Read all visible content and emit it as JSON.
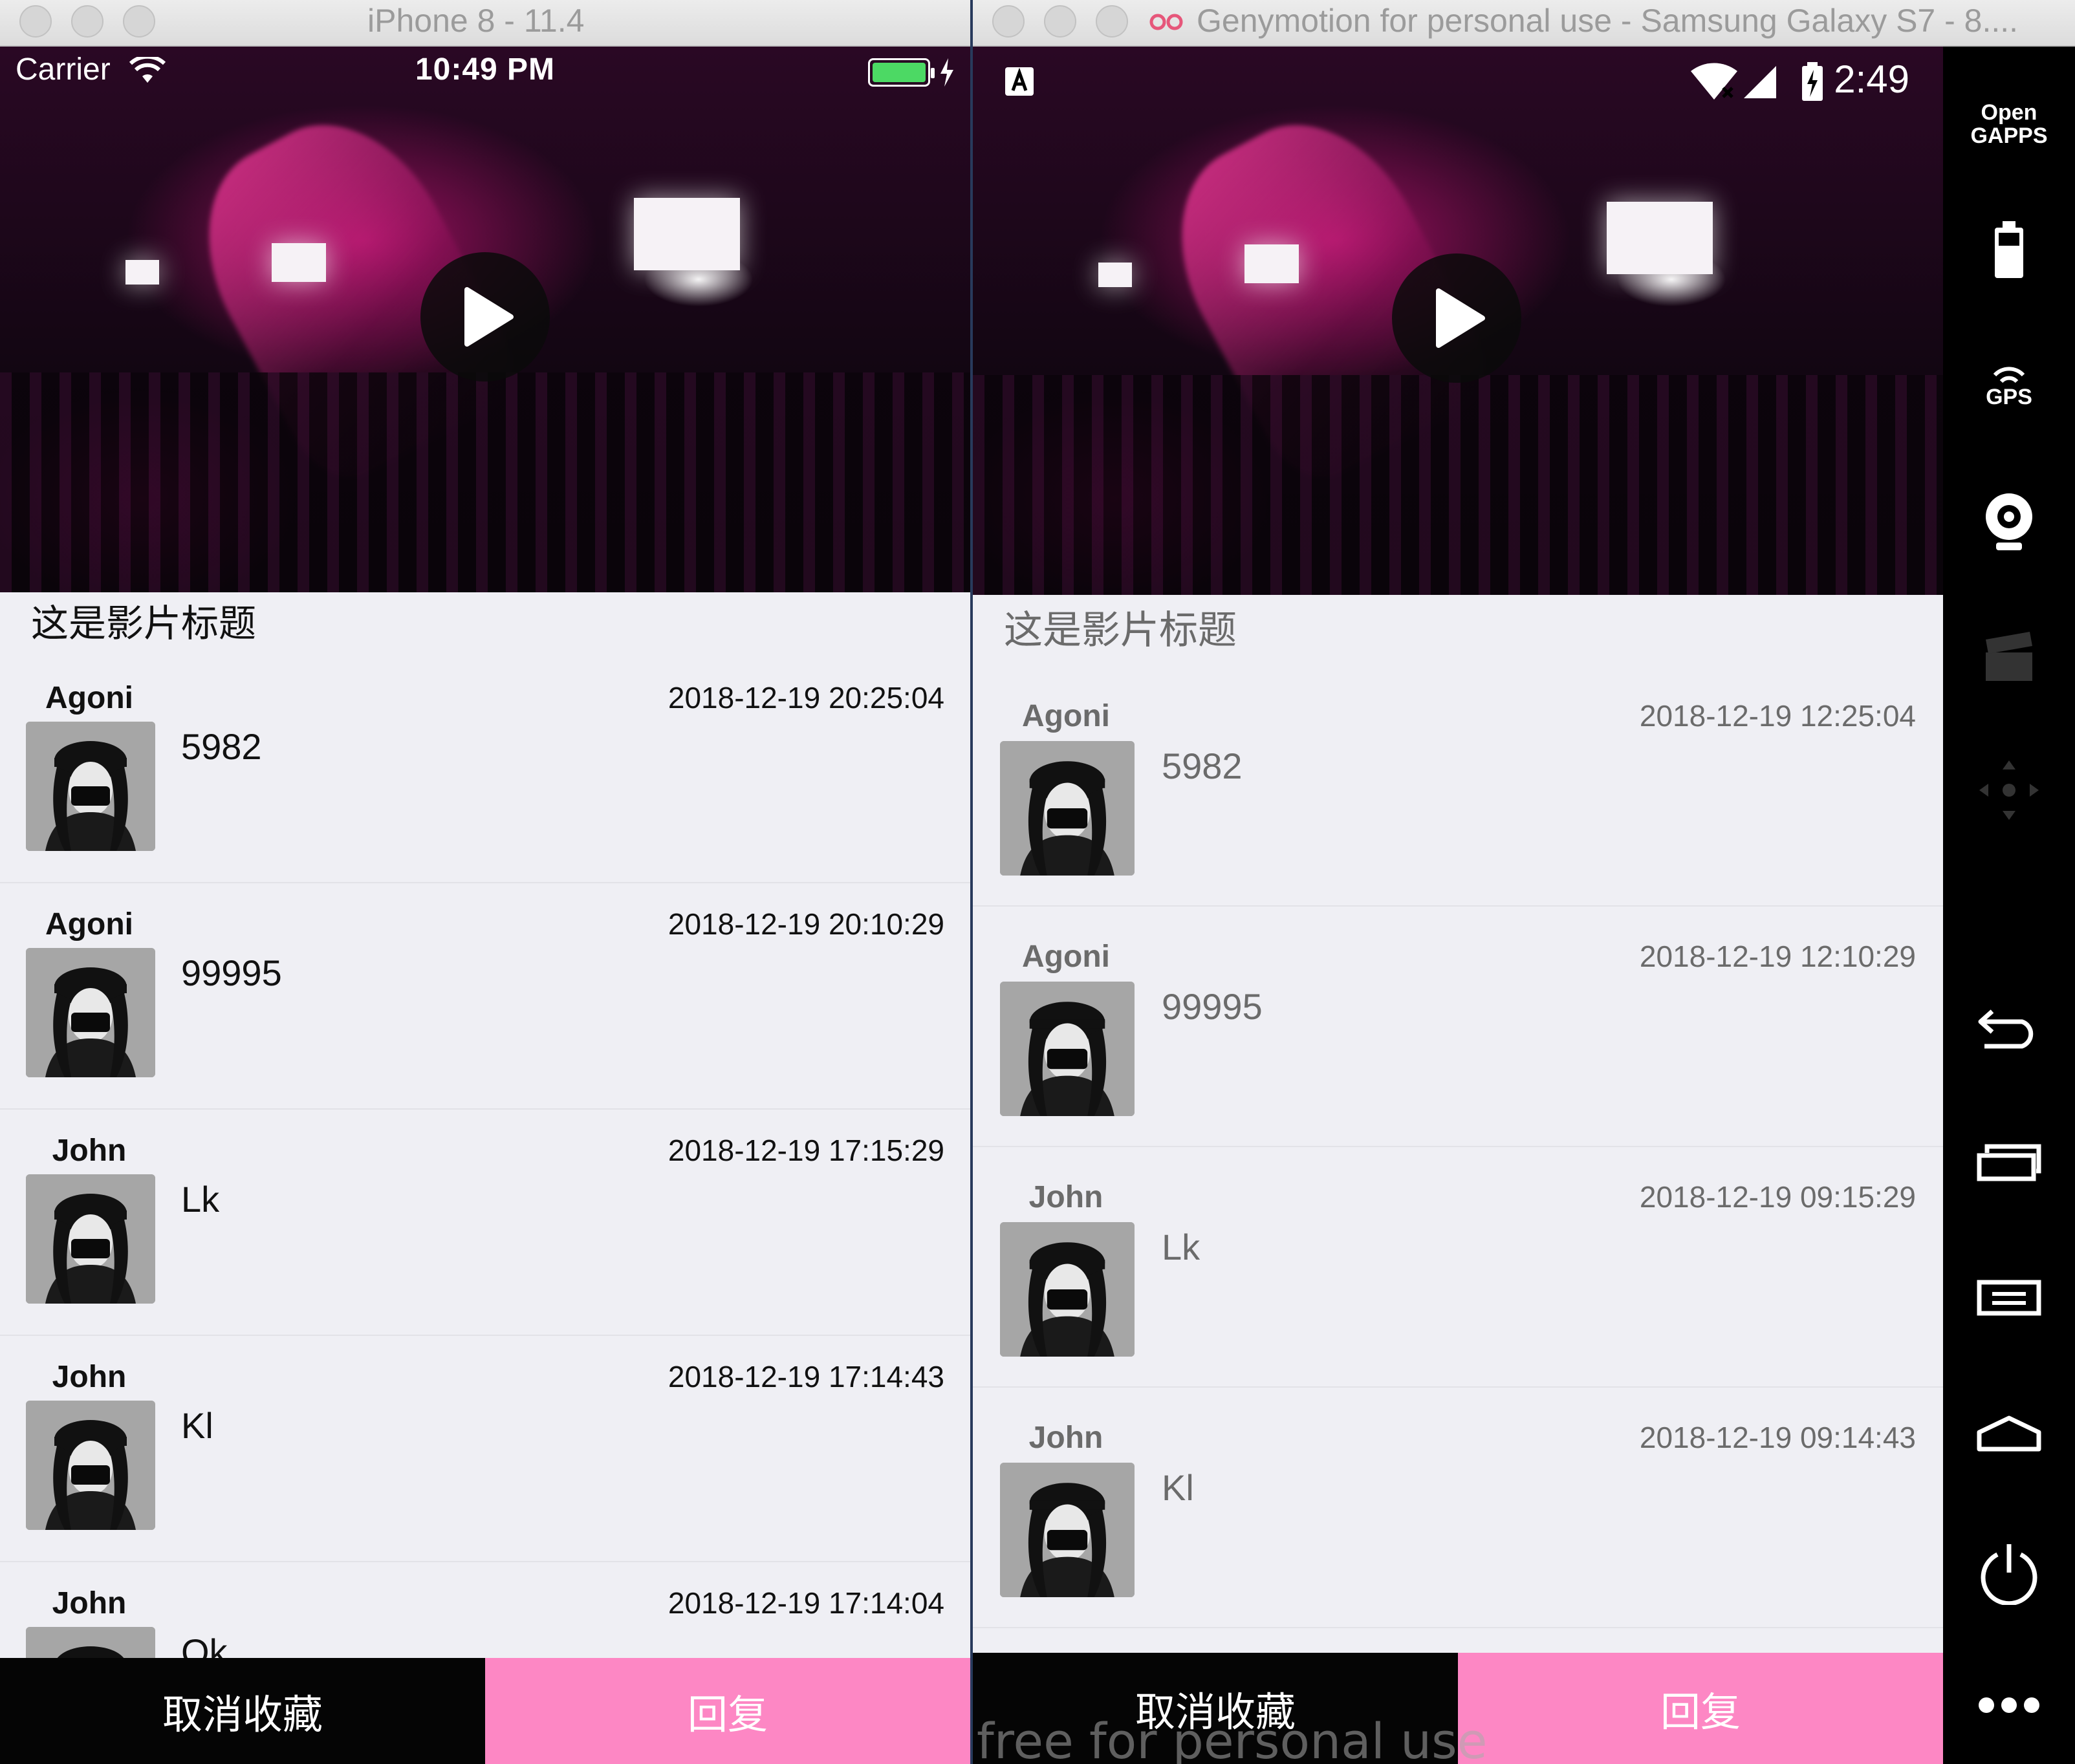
{
  "ios_window": {
    "title": "iPhone 8 - 11.4",
    "status": {
      "carrier": "Carrier",
      "time": "10:49 PM"
    },
    "movie_title": "这是影片标题",
    "comments": [
      {
        "user": "Agoni",
        "time": "2018-12-19 20:25:04",
        "text": "5982"
      },
      {
        "user": "Agoni",
        "time": "2018-12-19 20:10:29",
        "text": "99995"
      },
      {
        "user": "John",
        "time": "2018-12-19 17:15:29",
        "text": "Lk"
      },
      {
        "user": "John",
        "time": "2018-12-19 17:14:43",
        "text": "Kl"
      },
      {
        "user": "John",
        "time": "2018-12-19 17:14:04",
        "text": "Ok"
      }
    ],
    "bottom": {
      "cancel_label": "取消收藏",
      "reply_label": "回复"
    }
  },
  "android_window": {
    "title": "Genymotion for personal use - Samsung Galaxy S7 - 8....",
    "status": {
      "time": "2:49"
    },
    "movie_title": "这是影片标题",
    "comments": [
      {
        "user": "Agoni",
        "time": "2018-12-19 12:25:04",
        "text": "5982"
      },
      {
        "user": "Agoni",
        "time": "2018-12-19 12:10:29",
        "text": "99995"
      },
      {
        "user": "John",
        "time": "2018-12-19 09:15:29",
        "text": "Lk"
      },
      {
        "user": "John",
        "time": "2018-12-19 09:14:43",
        "text": "Kl"
      }
    ],
    "bottom": {
      "cancel_label": "取消收藏",
      "reply_label": "回复"
    },
    "watermark": "free for personal use",
    "sidebar": {
      "open_gapps_line1": "Open",
      "open_gapps_line2": "GAPPS",
      "gps_label": "GPS",
      "icons": [
        "open-gapps-icon",
        "battery-icon",
        "gps-icon",
        "webcam-icon",
        "clapperboard-icon",
        "dpad-icon",
        "back-icon",
        "recent-apps-icon",
        "menu-icon",
        "home-icon",
        "power-icon",
        "more-icon"
      ]
    }
  },
  "colors": {
    "reply": "#fd87c4",
    "cancel": "#050505",
    "list_bg": "#efeff4",
    "battery": "#4cd964"
  }
}
